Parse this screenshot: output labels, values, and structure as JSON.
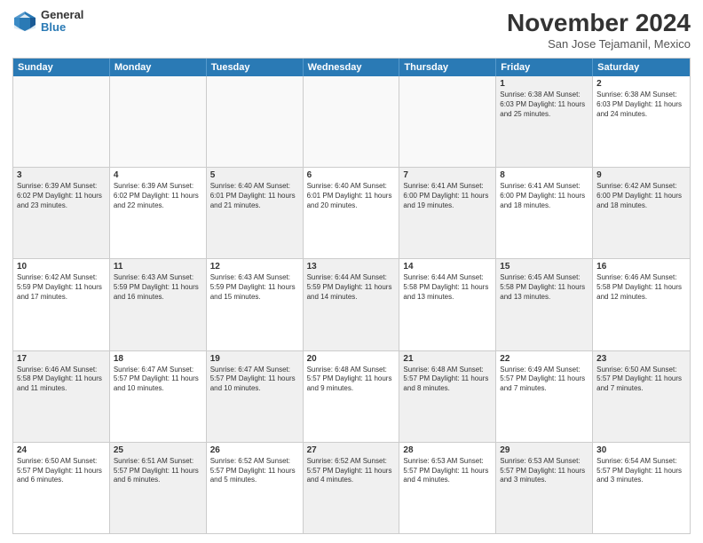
{
  "logo": {
    "general": "General",
    "blue": "Blue"
  },
  "title": "November 2024",
  "location": "San Jose Tejamanil, Mexico",
  "headers": [
    "Sunday",
    "Monday",
    "Tuesday",
    "Wednesday",
    "Thursday",
    "Friday",
    "Saturday"
  ],
  "rows": [
    [
      {
        "day": "",
        "text": "",
        "empty": true
      },
      {
        "day": "",
        "text": "",
        "empty": true
      },
      {
        "day": "",
        "text": "",
        "empty": true
      },
      {
        "day": "",
        "text": "",
        "empty": true
      },
      {
        "day": "",
        "text": "",
        "empty": true
      },
      {
        "day": "1",
        "text": "Sunrise: 6:38 AM\nSunset: 6:03 PM\nDaylight: 11 hours and 25 minutes.",
        "shaded": true
      },
      {
        "day": "2",
        "text": "Sunrise: 6:38 AM\nSunset: 6:03 PM\nDaylight: 11 hours and 24 minutes.",
        "shaded": false
      }
    ],
    [
      {
        "day": "3",
        "text": "Sunrise: 6:39 AM\nSunset: 6:02 PM\nDaylight: 11 hours and 23 minutes.",
        "shaded": true
      },
      {
        "day": "4",
        "text": "Sunrise: 6:39 AM\nSunset: 6:02 PM\nDaylight: 11 hours and 22 minutes.",
        "shaded": false
      },
      {
        "day": "5",
        "text": "Sunrise: 6:40 AM\nSunset: 6:01 PM\nDaylight: 11 hours and 21 minutes.",
        "shaded": true
      },
      {
        "day": "6",
        "text": "Sunrise: 6:40 AM\nSunset: 6:01 PM\nDaylight: 11 hours and 20 minutes.",
        "shaded": false
      },
      {
        "day": "7",
        "text": "Sunrise: 6:41 AM\nSunset: 6:00 PM\nDaylight: 11 hours and 19 minutes.",
        "shaded": true
      },
      {
        "day": "8",
        "text": "Sunrise: 6:41 AM\nSunset: 6:00 PM\nDaylight: 11 hours and 18 minutes.",
        "shaded": false
      },
      {
        "day": "9",
        "text": "Sunrise: 6:42 AM\nSunset: 6:00 PM\nDaylight: 11 hours and 18 minutes.",
        "shaded": true
      }
    ],
    [
      {
        "day": "10",
        "text": "Sunrise: 6:42 AM\nSunset: 5:59 PM\nDaylight: 11 hours and 17 minutes.",
        "shaded": false
      },
      {
        "day": "11",
        "text": "Sunrise: 6:43 AM\nSunset: 5:59 PM\nDaylight: 11 hours and 16 minutes.",
        "shaded": true
      },
      {
        "day": "12",
        "text": "Sunrise: 6:43 AM\nSunset: 5:59 PM\nDaylight: 11 hours and 15 minutes.",
        "shaded": false
      },
      {
        "day": "13",
        "text": "Sunrise: 6:44 AM\nSunset: 5:59 PM\nDaylight: 11 hours and 14 minutes.",
        "shaded": true
      },
      {
        "day": "14",
        "text": "Sunrise: 6:44 AM\nSunset: 5:58 PM\nDaylight: 11 hours and 13 minutes.",
        "shaded": false
      },
      {
        "day": "15",
        "text": "Sunrise: 6:45 AM\nSunset: 5:58 PM\nDaylight: 11 hours and 13 minutes.",
        "shaded": true
      },
      {
        "day": "16",
        "text": "Sunrise: 6:46 AM\nSunset: 5:58 PM\nDaylight: 11 hours and 12 minutes.",
        "shaded": false
      }
    ],
    [
      {
        "day": "17",
        "text": "Sunrise: 6:46 AM\nSunset: 5:58 PM\nDaylight: 11 hours and 11 minutes.",
        "shaded": true
      },
      {
        "day": "18",
        "text": "Sunrise: 6:47 AM\nSunset: 5:57 PM\nDaylight: 11 hours and 10 minutes.",
        "shaded": false
      },
      {
        "day": "19",
        "text": "Sunrise: 6:47 AM\nSunset: 5:57 PM\nDaylight: 11 hours and 10 minutes.",
        "shaded": true
      },
      {
        "day": "20",
        "text": "Sunrise: 6:48 AM\nSunset: 5:57 PM\nDaylight: 11 hours and 9 minutes.",
        "shaded": false
      },
      {
        "day": "21",
        "text": "Sunrise: 6:48 AM\nSunset: 5:57 PM\nDaylight: 11 hours and 8 minutes.",
        "shaded": true
      },
      {
        "day": "22",
        "text": "Sunrise: 6:49 AM\nSunset: 5:57 PM\nDaylight: 11 hours and 7 minutes.",
        "shaded": false
      },
      {
        "day": "23",
        "text": "Sunrise: 6:50 AM\nSunset: 5:57 PM\nDaylight: 11 hours and 7 minutes.",
        "shaded": true
      }
    ],
    [
      {
        "day": "24",
        "text": "Sunrise: 6:50 AM\nSunset: 5:57 PM\nDaylight: 11 hours and 6 minutes.",
        "shaded": false
      },
      {
        "day": "25",
        "text": "Sunrise: 6:51 AM\nSunset: 5:57 PM\nDaylight: 11 hours and 6 minutes.",
        "shaded": true
      },
      {
        "day": "26",
        "text": "Sunrise: 6:52 AM\nSunset: 5:57 PM\nDaylight: 11 hours and 5 minutes.",
        "shaded": false
      },
      {
        "day": "27",
        "text": "Sunrise: 6:52 AM\nSunset: 5:57 PM\nDaylight: 11 hours and 4 minutes.",
        "shaded": true
      },
      {
        "day": "28",
        "text": "Sunrise: 6:53 AM\nSunset: 5:57 PM\nDaylight: 11 hours and 4 minutes.",
        "shaded": false
      },
      {
        "day": "29",
        "text": "Sunrise: 6:53 AM\nSunset: 5:57 PM\nDaylight: 11 hours and 3 minutes.",
        "shaded": true
      },
      {
        "day": "30",
        "text": "Sunrise: 6:54 AM\nSunset: 5:57 PM\nDaylight: 11 hours and 3 minutes.",
        "shaded": false
      }
    ]
  ]
}
